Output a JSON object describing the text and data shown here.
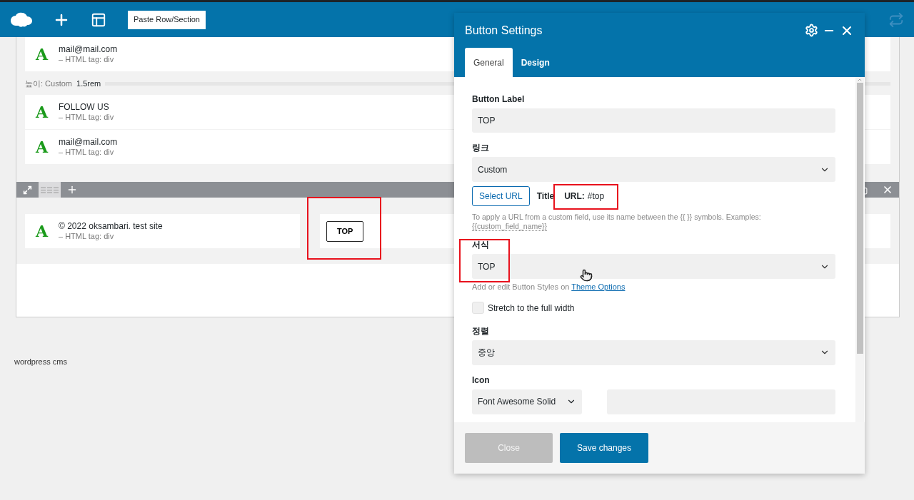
{
  "toolbar": {
    "paste_button": "Paste Row/Section"
  },
  "section": {
    "items": [
      {
        "kind": "module",
        "glyph": "A",
        "title": "mail@mail.com",
        "subtitle": "– HTML tag: div"
      },
      {
        "kind": "spacer",
        "label": "높이: Custom",
        "value": "1.5rem"
      },
      {
        "kind": "module",
        "glyph": "A",
        "title": "FOLLOW US",
        "subtitle": "– HTML tag: div"
      },
      {
        "kind": "module",
        "glyph": "A",
        "title": "mail@mail.com",
        "subtitle": "– HTML tag: div"
      }
    ]
  },
  "row": {
    "module": {
      "glyph": "A",
      "title": "© 2022 oksambari. test site",
      "subtitle": "– HTML tag: div"
    },
    "button": {
      "label": "TOP"
    }
  },
  "footer_text": "wordpress cms",
  "dialog": {
    "title": "Button Settings",
    "tabs": [
      {
        "label": "General",
        "selected": true
      },
      {
        "label": "Design",
        "selected": false
      }
    ],
    "fields": [
      {
        "kind": "input",
        "label": "Button Label",
        "value": "TOP"
      },
      {
        "kind": "select",
        "label": "링크",
        "value": "Custom"
      },
      {
        "kind": "url",
        "button": "Select URL",
        "title_label": "Title",
        "url_label": "URL:",
        "url_value": "#top",
        "help": "To apply a URL from a custom field, use its name between the {{ }} symbols. Examples:",
        "help_example": "{{custom_field_name}}"
      },
      {
        "kind": "select",
        "label": "서식",
        "value": "TOP",
        "hint": "Add or edit Button Styles on",
        "hint_link": "Theme Options"
      },
      {
        "kind": "checkbox",
        "label": "Stretch to the full width",
        "checked": false
      },
      {
        "kind": "select",
        "label": "정렬",
        "value": "중앙"
      },
      {
        "kind": "icon",
        "label": "Icon",
        "value": "Font Awesome Solid"
      }
    ],
    "buttons": [
      {
        "label": "Close",
        "kind": "secondary"
      },
      {
        "label": "Save changes",
        "kind": "primary"
      }
    ]
  }
}
